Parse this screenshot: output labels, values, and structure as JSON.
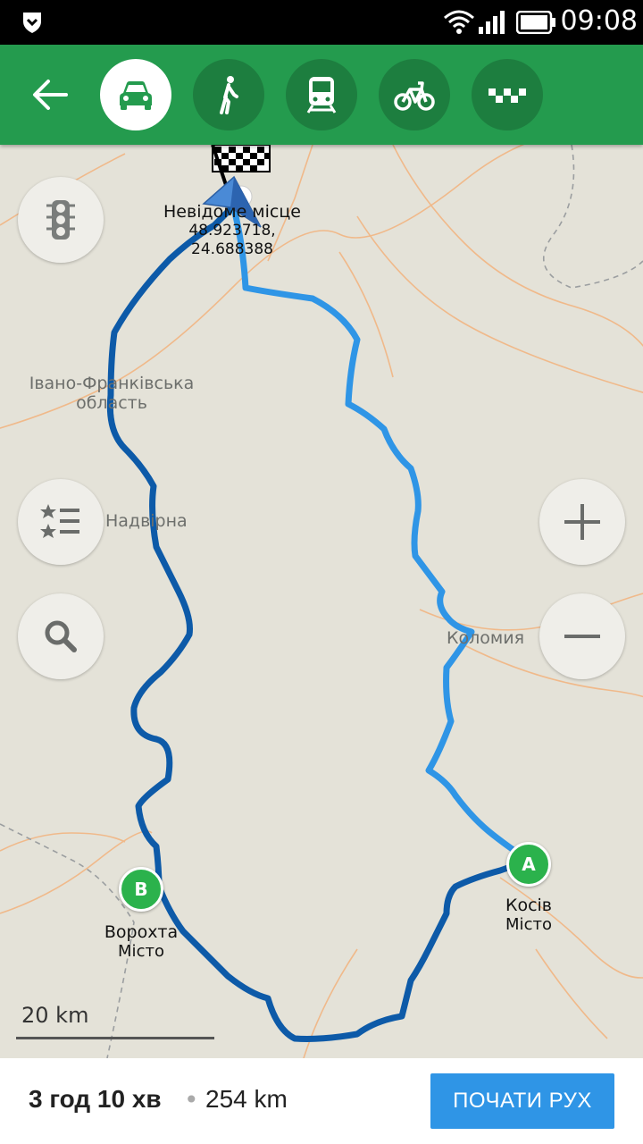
{
  "status_bar": {
    "time": "09:08"
  },
  "toolbar": {
    "modes": [
      {
        "name": "car",
        "active": true
      },
      {
        "name": "walk",
        "active": false
      },
      {
        "name": "transit",
        "active": false
      },
      {
        "name": "bike",
        "active": false
      },
      {
        "name": "taxi",
        "active": false
      }
    ]
  },
  "map": {
    "region_label_line1": "Івано-Франківська",
    "region_label_line2": "область",
    "city_nadvirna": "Надвірна",
    "city_kolomyia": "Коломия",
    "destination": {
      "name": "Невідоме місце",
      "coords_line1": "48.923718,",
      "coords_line2": "24.688388"
    },
    "point_a": {
      "marker": "A",
      "name": "Косів",
      "type": "Місто"
    },
    "point_b": {
      "marker": "B",
      "name": "Ворохта",
      "type": "Місто"
    },
    "scale": "20 km"
  },
  "route": {
    "duration": "3 год 10 хв",
    "separator": "•",
    "distance": "254 km",
    "start_label": "ПОЧАТИ РУХ"
  },
  "colors": {
    "toolbar": "#249b4e",
    "route_primary": "#2f95e6",
    "route_alternative": "#0d5aa8",
    "marker": "#2bb24c"
  }
}
